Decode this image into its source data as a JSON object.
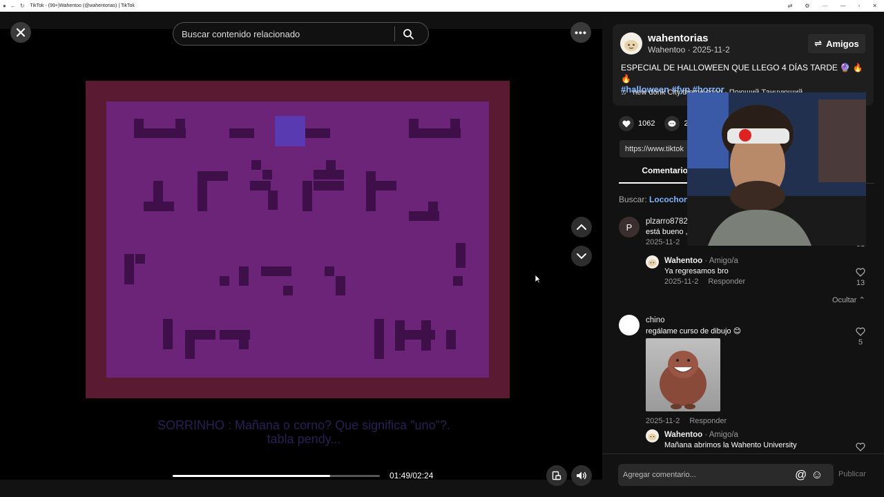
{
  "window": {
    "title": "TikTok - (99+)Wahentoo (@wahentorias) | TikTok"
  },
  "search": {
    "placeholder": "Buscar contenido relacionado"
  },
  "video": {
    "subtitle_line1": "SORRINHO : Mañana o corno? Que significa \"uno\"?.",
    "subtitle_line2": "tabla pendy...",
    "time": "01:49/02:24",
    "progress": 0.76
  },
  "author": {
    "username": "wahentorias",
    "display": "Wahentoo · 2025-11-2",
    "friends_label": "Amigos"
  },
  "post": {
    "description": "ESPECIAL DE HALLOWEEN QUE LLEGO 4 DÍAS TARDE",
    "emojis": "🔮 🔥 🔥",
    "tags": [
      "#halloween",
      "#fyp",
      "#horror"
    ],
    "music": "new donk City theme song - Поющий Танцующий"
  },
  "stats": {
    "likes": "1062",
    "comments": "2"
  },
  "link": "https://www.tiktok",
  "tabs": {
    "comments": "Comentarios"
  },
  "search_related": {
    "label": "Buscar:",
    "term": "Locochon"
  },
  "comments": [
    {
      "avatar": "P",
      "name": "plzarro8782",
      "text": "está bueno ,",
      "date": "2025-11-2",
      "likes": "31"
    },
    {
      "name": "Wahentoo",
      "badge": "· Amigo/a",
      "text": "Ya regresamos bro",
      "date": "2025-11-2",
      "reply": "Responder",
      "likes": "13"
    },
    {
      "name": "chino",
      "text": "regálame curso de dibujo",
      "date": "2025-11-2",
      "reply": "Responder",
      "likes": "5"
    },
    {
      "name": "Wahentoo",
      "badge": "· Amigo/a",
      "text": "Mañana abrimos la Wahento University"
    }
  ],
  "hide_label": "Ocultar",
  "composer": {
    "placeholder": "Agregar comentario...",
    "publish": "Publicar"
  }
}
